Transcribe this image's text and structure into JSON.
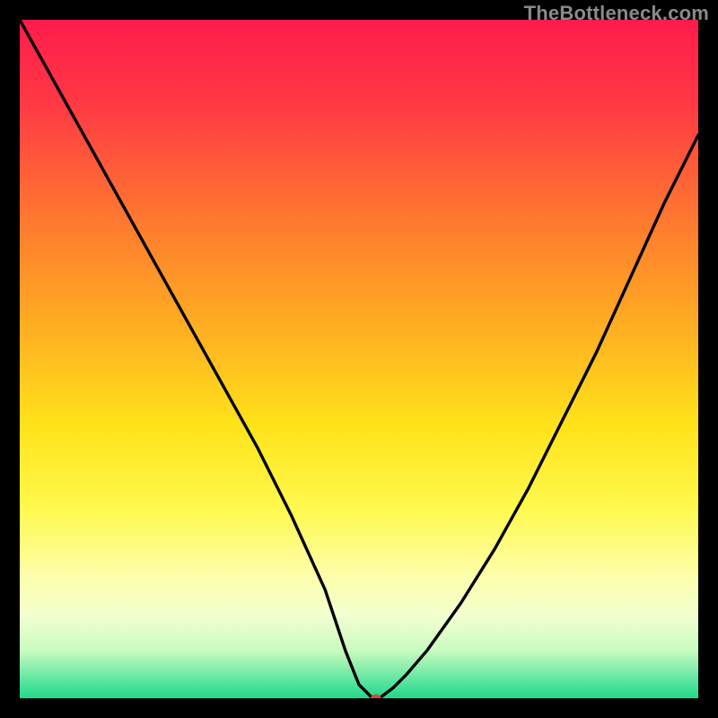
{
  "watermark": "TheBottleneck.com",
  "chart_data": {
    "type": "line",
    "title": "",
    "xlabel": "",
    "ylabel": "",
    "xlim": [
      0,
      100
    ],
    "ylim": [
      0,
      100
    ],
    "legend": false,
    "grid": false,
    "annotations": [],
    "series": [
      {
        "name": "curve",
        "x": [
          0,
          5,
          10,
          15,
          20,
          25,
          30,
          35,
          40,
          45,
          48,
          50,
          52,
          53,
          55,
          57,
          60,
          65,
          70,
          75,
          80,
          85,
          90,
          95,
          100
        ],
        "values": [
          100,
          91,
          82,
          73,
          64,
          55,
          46,
          37,
          27,
          16,
          7,
          2,
          0,
          0,
          1.5,
          3.5,
          7,
          14,
          22,
          31,
          41,
          51,
          62,
          73,
          83
        ]
      }
    ],
    "marker": {
      "name": "highlight-point",
      "x": 52.5,
      "y": 0,
      "color": "#d24a3a",
      "rx": 6,
      "ry": 4.5
    },
    "background_gradient": {
      "type": "vertical-gradient",
      "stops": [
        {
          "pos": 0.0,
          "color": "#ff1b4c"
        },
        {
          "pos": 0.13,
          "color": "#ff3b43"
        },
        {
          "pos": 0.3,
          "color": "#ff7a2f"
        },
        {
          "pos": 0.45,
          "color": "#ffad22"
        },
        {
          "pos": 0.6,
          "color": "#ffe31a"
        },
        {
          "pos": 0.72,
          "color": "#fff94e"
        },
        {
          "pos": 0.82,
          "color": "#fdffab"
        },
        {
          "pos": 0.88,
          "color": "#f2ffd0"
        },
        {
          "pos": 0.93,
          "color": "#c8fbc0"
        },
        {
          "pos": 0.97,
          "color": "#66e7a2"
        },
        {
          "pos": 1.0,
          "color": "#1fd88b"
        }
      ]
    }
  }
}
